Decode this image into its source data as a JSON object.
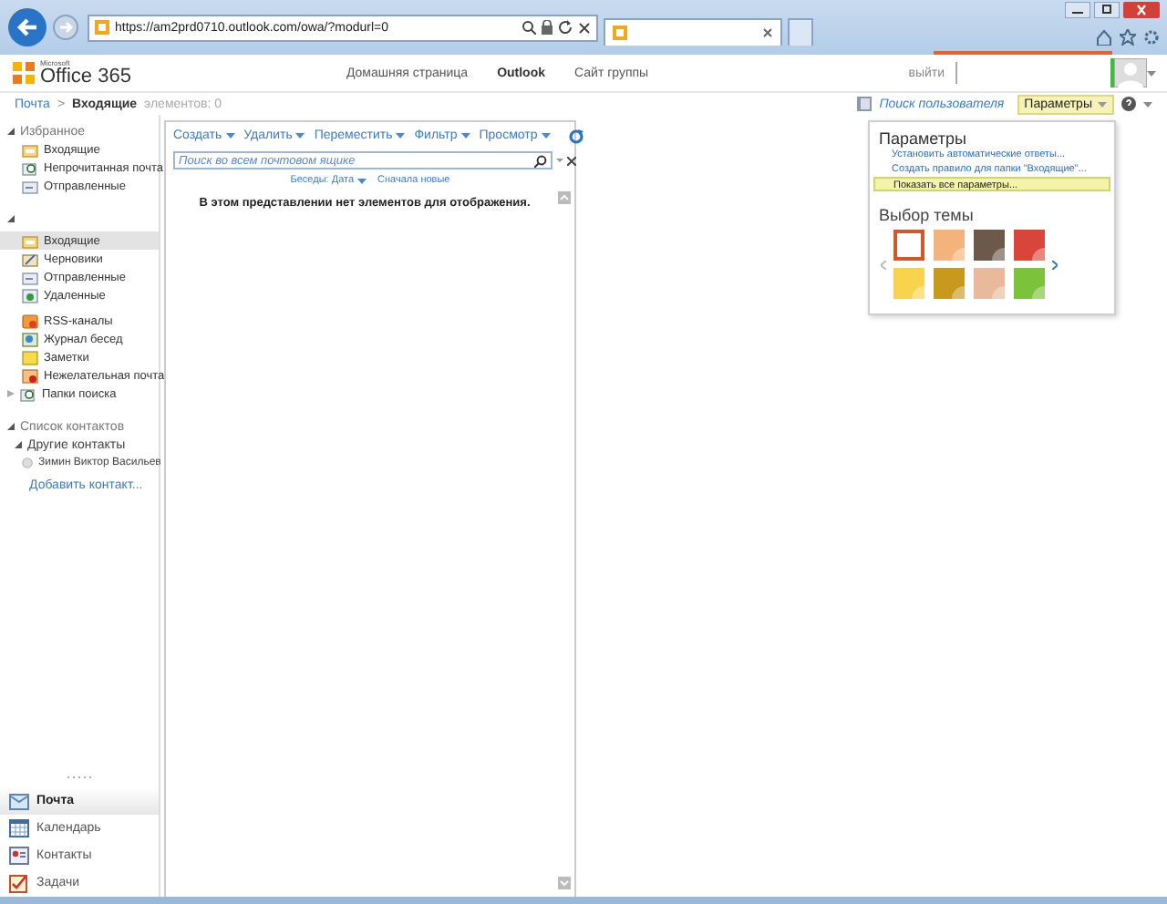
{
  "browser": {
    "address": "https://am2prd0710.outlook.com/owa/?modurl=0"
  },
  "header": {
    "logo_brand": "Microsoft",
    "logo": "Office 365",
    "nav": [
      {
        "label": "Домашняя страница",
        "selected": false
      },
      {
        "label": "Outlook",
        "selected": true
      },
      {
        "label": "Сайт группы",
        "selected": false
      }
    ],
    "signout": "выйти"
  },
  "breadcrumb": {
    "root": "Почта",
    "separator": ">",
    "current": "Входящие",
    "count": "элементов: 0"
  },
  "top_actions": {
    "find_people": "Поиск пользователя",
    "options": "Параметры"
  },
  "favorites": {
    "title": "Избранное",
    "expanded": true,
    "items": [
      {
        "label": "Входящие",
        "kind": "inbox",
        "selected": false
      },
      {
        "label": "Непрочитанная почта",
        "kind": "search",
        "selected": false
      },
      {
        "label": "Отправленные",
        "kind": "sent",
        "selected": false
      }
    ]
  },
  "mailbox": {
    "expanded": true,
    "groups": [
      [
        {
          "label": "Входящие",
          "kind": "inbox",
          "selected": true
        },
        {
          "label": "Черновики",
          "kind": "drafts",
          "selected": false
        },
        {
          "label": "Отправленные",
          "kind": "sent",
          "selected": false
        },
        {
          "label": "Удаленные",
          "kind": "deleted",
          "selected": false
        }
      ],
      [
        {
          "label": "RSS-каналы",
          "kind": "rss",
          "selected": false
        },
        {
          "label": "Журнал бесед",
          "kind": "conversation",
          "selected": false
        },
        {
          "label": "Заметки",
          "kind": "notes",
          "selected": false
        },
        {
          "label": "Нежелательная почта",
          "kind": "junk",
          "selected": false
        },
        {
          "label": "Папки поиска",
          "kind": "search",
          "selected": false,
          "expanded": false
        }
      ]
    ]
  },
  "contacts": {
    "title": "Список контактов",
    "expanded": true,
    "group": {
      "title": "Другие контакты",
      "expanded": true,
      "items": [
        "Зимин Виктор Васильев"
      ]
    },
    "add_link": "Добавить контакт..."
  },
  "modules": [
    {
      "label": "Почта",
      "kind": "mail",
      "selected": true
    },
    {
      "label": "Календарь",
      "kind": "calendar",
      "selected": false
    },
    {
      "label": "Контакты",
      "kind": "contacts",
      "selected": false
    },
    {
      "label": "Задачи",
      "kind": "tasks",
      "selected": false
    }
  ],
  "toolbar": [
    "Создать",
    "Удалить",
    "Переместить",
    "Фильтр",
    "Просмотр"
  ],
  "search": {
    "placeholder": "Поиск во всем почтовом ящике"
  },
  "sort": {
    "arrange": "Беседы: Дата",
    "order": "Сначала новые"
  },
  "empty_message": "В этом представлении нет элементов для отображения.",
  "options_menu": {
    "title": "Параметры",
    "items": [
      {
        "label": "Установить автоматические ответы...",
        "selected": false
      },
      {
        "label": "Создать правило для папки \"Входящие\"...",
        "selected": false
      },
      {
        "label": "Показать все параметры...",
        "selected": true
      }
    ],
    "theme_title": "Выбор темы",
    "themes": [
      {
        "color": "#ffffff",
        "selected": true
      },
      {
        "color": "#f4b27c",
        "selected": false
      },
      {
        "color": "#6b5a4a",
        "selected": false
      },
      {
        "color": "#d9453a",
        "selected": false
      },
      {
        "color": "#f7d44c",
        "selected": false
      },
      {
        "color": "#c79a1e",
        "selected": false
      },
      {
        "color": "#e8b99a",
        "selected": false
      },
      {
        "color": "#7cc23a",
        "selected": false
      }
    ]
  }
}
